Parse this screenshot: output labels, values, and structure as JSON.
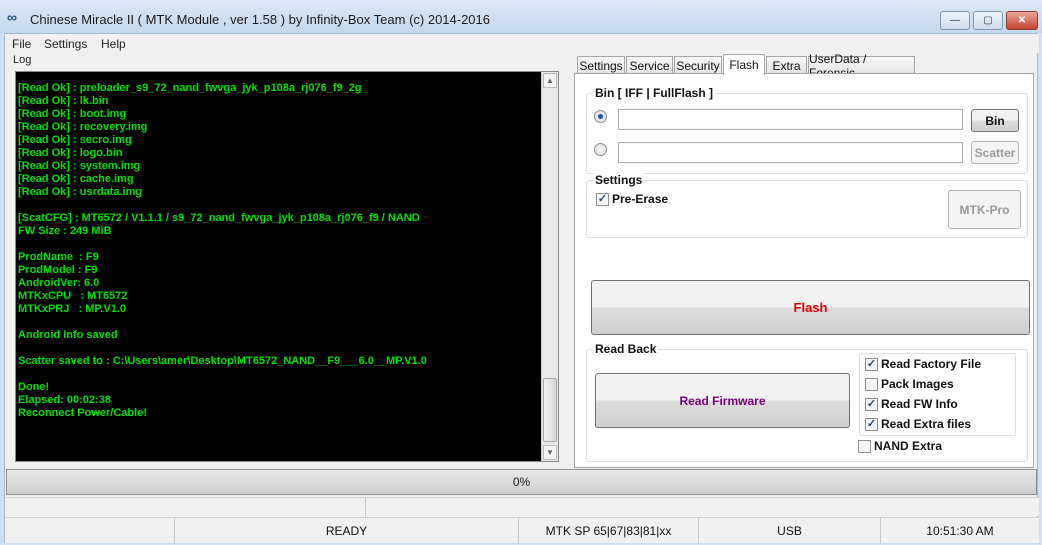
{
  "window": {
    "title": "Chinese Miracle II ( MTK Module , ver 1.58 ) by Infinity-Box Team (c) 2014-2016",
    "minimize_glyph": "—",
    "maximize_glyph": "▢",
    "close_glyph": "✕"
  },
  "menu": {
    "file": "File",
    "settings": "Settings",
    "help": "Help"
  },
  "log": {
    "label": "Log",
    "lines": [
      "[Read Ok] : preloader_s9_72_nand_fwvga_jyk_p108a_rj076_f9_2g_",
      "[Read Ok] : lk.bin",
      "[Read Ok] : boot.img",
      "[Read Ok] : recovery.img",
      "[Read Ok] : secro.img",
      "[Read Ok] : logo.bin",
      "[Read Ok] : system.img",
      "[Read Ok] : cache.img",
      "[Read Ok] : usrdata.img",
      "",
      "[ScatCFG] : MT6572 / V1.1.1 / s9_72_nand_fwvga_jyk_p108a_rj076_f9 / NAND",
      "FW Size : 249 MiB",
      "",
      "ProdName  : F9",
      "ProdModel : F9",
      "AndroidVer: 6.0",
      "MTKxCPU   : MT6572",
      "MTKxPRJ   : MP.V1.0",
      "",
      "Android Info saved",
      "",
      "Scatter saved to : C:\\Users\\amer\\Desktop\\MT6572_NAND__F9___6.0__MP.V1.0",
      "",
      "Done!",
      "Elapsed: 00:02:38",
      "Reconnect Power/Cable!"
    ]
  },
  "tabs": [
    "Settings",
    "Service",
    "Security",
    "Flash",
    "Extra",
    "UserData / Forensic"
  ],
  "flash": {
    "bin_group_title": "Bin  [ IFF | FullFlash ]",
    "bin_button": "Bin",
    "scatter_button": "Scatter",
    "bin_field_1": "",
    "bin_field_2": "",
    "settings_title": "Settings",
    "pre_erase_label": "Pre-Erase",
    "mtk_pro_button": "MTK-Pro",
    "flash_button": "Flash",
    "readback_title": "Read Back",
    "read_firmware_button": "Read Firmware",
    "options": [
      {
        "label": "Read Factory File",
        "checked": true
      },
      {
        "label": "Pack Images",
        "checked": false
      },
      {
        "label": "Read FW Info",
        "checked": true
      },
      {
        "label": "Read Extra files",
        "checked": true
      }
    ],
    "nand_extra": {
      "label": "NAND Extra",
      "checked": false
    }
  },
  "progress": {
    "value": 0,
    "text": "0%"
  },
  "status": {
    "ready": "READY",
    "mtk_sp": "MTK SP 65|67|83|81|xx",
    "usb": "USB",
    "time": "10:51:30 AM"
  },
  "colors": {
    "log_bg": "#000000",
    "log_text": "#00e000",
    "flash_text": "#e00000",
    "read_firmware_text": "#7a007a"
  },
  "icons": {
    "app": "infinity-box-icon",
    "check": "checkmark-icon"
  }
}
